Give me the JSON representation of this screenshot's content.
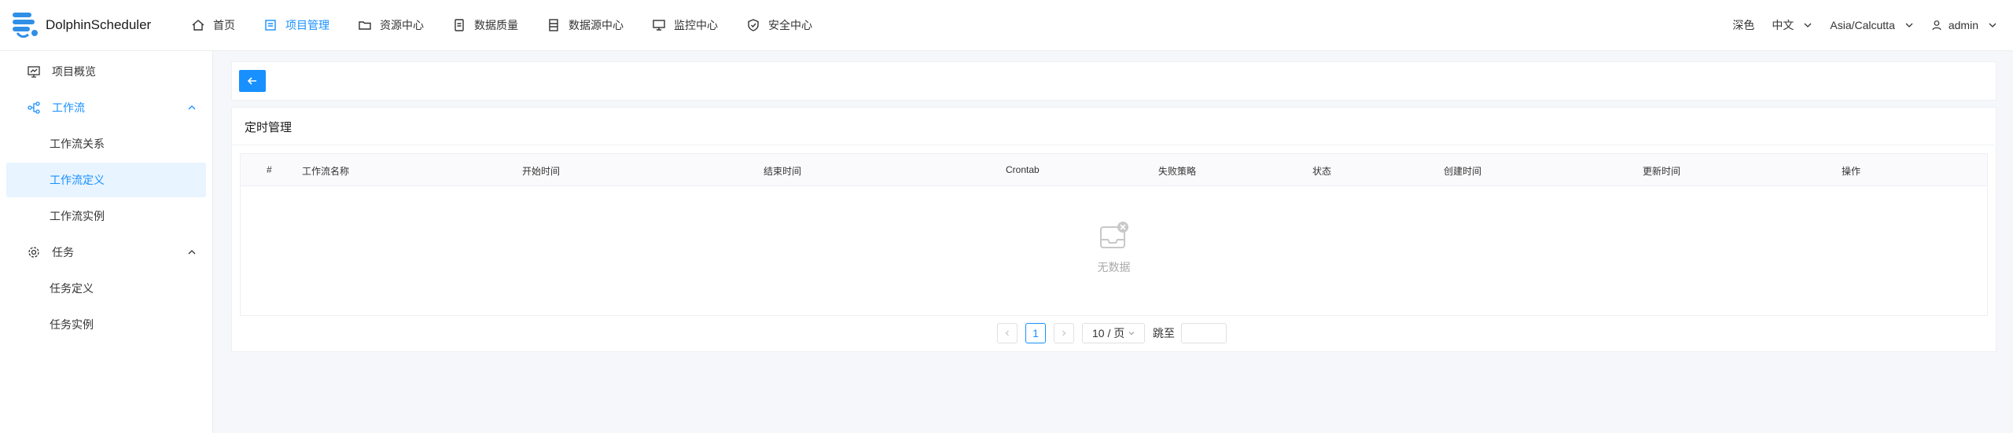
{
  "header": {
    "brand": "DolphinScheduler",
    "nav": [
      {
        "label": "首页",
        "icon": "home-icon"
      },
      {
        "label": "项目管理",
        "icon": "project-icon"
      },
      {
        "label": "资源中心",
        "icon": "folder-icon"
      },
      {
        "label": "数据质量",
        "icon": "data-quality-icon"
      },
      {
        "label": "数据源中心",
        "icon": "datasource-icon"
      },
      {
        "label": "监控中心",
        "icon": "monitor-icon"
      },
      {
        "label": "安全中心",
        "icon": "shield-icon"
      }
    ],
    "active_nav": 1,
    "theme": "深色",
    "language": "中文",
    "timezone": "Asia/Calcutta",
    "user": "admin"
  },
  "sidebar": {
    "items": [
      {
        "label": "项目概览"
      },
      {
        "label": "工作流"
      },
      {
        "label": "工作流关系"
      },
      {
        "label": "工作流定义"
      },
      {
        "label": "工作流实例"
      },
      {
        "label": "任务"
      },
      {
        "label": "任务定义"
      },
      {
        "label": "任务实例"
      }
    ]
  },
  "main": {
    "section_title": "定时管理",
    "table": {
      "columns": [
        "#",
        "工作流名称",
        "开始时间",
        "结束时间",
        "Crontab",
        "失败策略",
        "状态",
        "创建时间",
        "更新时间",
        "操作"
      ],
      "empty_text": "无数据"
    },
    "pagination": {
      "current_page": "1",
      "page_size": "10 / 页",
      "jump_label": "跳至"
    }
  },
  "colors": {
    "accent": "#1890ff",
    "selected_bg": "#e8f4ff",
    "page_bg": "#f5f7fa"
  }
}
